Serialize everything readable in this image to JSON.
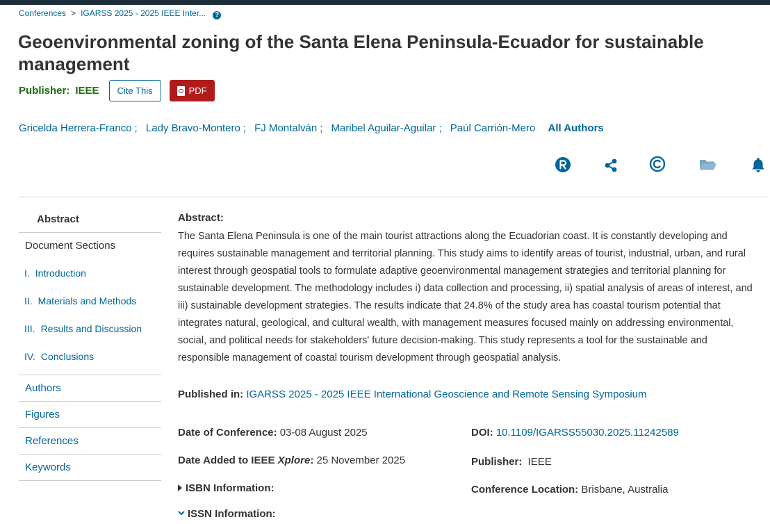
{
  "breadcrumb": {
    "items": [
      "Conferences",
      "IGARSS 2025 - 2025 IEEE Inter..."
    ],
    "separator": ">"
  },
  "article": {
    "title": "Geoenvironmental zoning of the Santa Elena Peninsula-Ecuador for sustainable management",
    "publisher_label": "Publisher:",
    "publisher_name": "IEEE",
    "cite_button": "Cite This",
    "pdf_button": "PDF",
    "authors": [
      "Gricelda Herrera-Franco",
      "Lady Bravo-Montero",
      "FJ Montalván",
      "Maribel Aguilar-Aguilar",
      "Paúl Carrión-Mero"
    ],
    "author_separator": ";",
    "all_authors": "All Authors"
  },
  "action_icons": [
    "rights-r-icon",
    "share-icon",
    "copyright-icon",
    "folder-icon",
    "bell-icon"
  ],
  "sidebar": {
    "abstract": "Abstract",
    "document_sections_label": "Document Sections",
    "sections": [
      {
        "num": "I.",
        "label": "Introduction"
      },
      {
        "num": "II.",
        "label": "Materials and Methods"
      },
      {
        "num": "III.",
        "label": "Results and Discussion"
      },
      {
        "num": "IV.",
        "label": "Conclusions"
      }
    ],
    "links": [
      "Authors",
      "Figures",
      "References",
      "Keywords"
    ]
  },
  "abstract": {
    "label": "Abstract:",
    "text": "The Santa Elena Peninsula is one of the main tourist attractions along the Ecuadorian coast. It is constantly developing and requires sustainable management and territorial planning. This study aims to identify areas of tourist, industrial, urban, and rural interest through geospatial tools to formulate adaptive geoenvironmental management strategies and territorial planning for sustainable development. The methodology includes i) data collection and processing, ii) spatial analysis of areas of interest, and iii) sustainable development strategies. The results indicate that 24.8% of the study area has coastal tourism potential that integrates natural, geological, and cultural wealth, with management measures focused mainly on addressing environmental, social, and political needs for stakeholders' future decision-making. This study represents a tool for the sustainable and responsible management of coastal tourism development through geospatial analysis."
  },
  "metadata": {
    "published_in_label": "Published in:",
    "published_in_value": "IGARSS 2025 - 2025 IEEE International Geoscience and Remote Sensing Symposium",
    "date_of_conference_label": "Date of Conference:",
    "date_of_conference_value": "03-08 August 2025",
    "date_added_label_prefix": "Date Added to IEEE",
    "date_added_label_italic": "Xplore",
    "date_added_label_suffix": ":",
    "date_added_value": "25 November 2025",
    "isbn_label": "ISBN Information:",
    "issn_label": "ISSN Information:",
    "doi_label": "DOI:",
    "doi_value": "10.1109/IGARSS55030.2025.11242589",
    "publisher_label": "Publisher:",
    "publisher_value": "IEEE",
    "location_label": "Conference Location:",
    "location_value": "Brisbane, Australia"
  },
  "colors": {
    "link": "#006699",
    "publisher_green": "#1b6d0f",
    "pdf_red": "#b01c1c",
    "top_bar": "#1d2e3a"
  }
}
